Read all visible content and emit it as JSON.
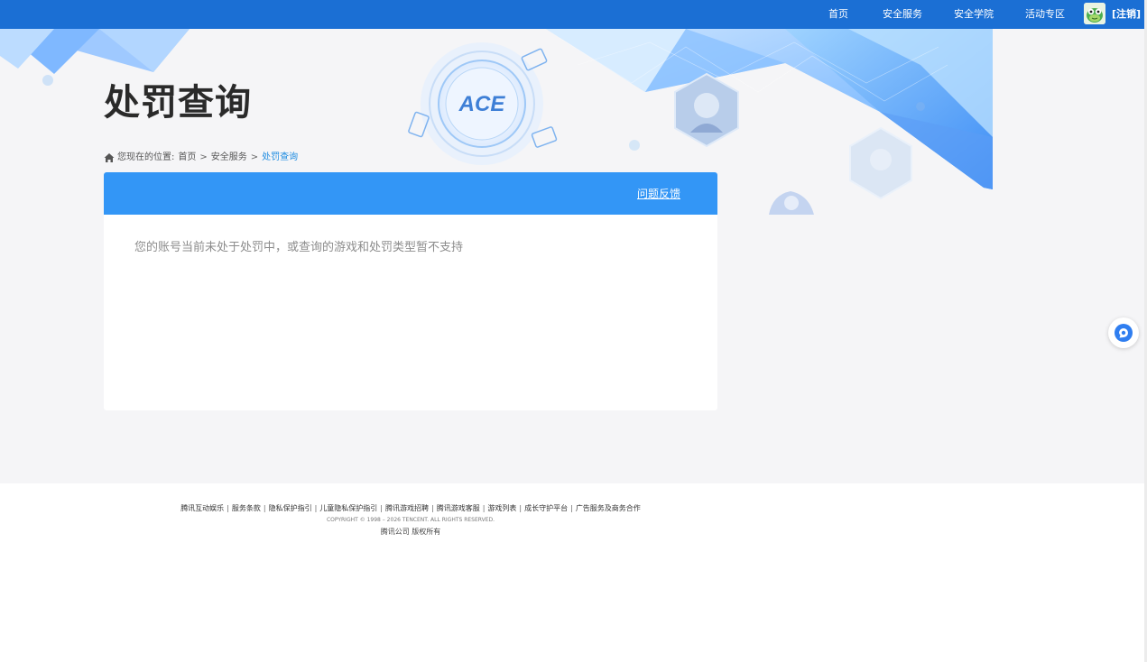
{
  "nav": {
    "items": [
      {
        "label": "首页"
      },
      {
        "label": "安全服务"
      },
      {
        "label": "安全学院"
      },
      {
        "label": "活动专区"
      }
    ],
    "logout_label": "[注销]",
    "avatar_icon": "user-avatar-icon"
  },
  "banner": {
    "logo_text": "ACE"
  },
  "page": {
    "title": "处罚查询"
  },
  "breadcrumb": {
    "prefix": "您现在的位置:",
    "items": [
      "首页",
      "安全服务",
      "处罚查询"
    ],
    "separator": ">",
    "icon": "home-icon"
  },
  "panel": {
    "feedback_label": "问题反馈",
    "empty_message": "您的账号当前未处于处罚中，或查询的游戏和处罚类型暂不支持"
  },
  "floating": {
    "icon": "chat-bubble-icon"
  },
  "footer": {
    "links": [
      "腾讯互动娱乐",
      "服务条款",
      "隐私保护指引",
      "儿童隐私保护指引",
      "腾讯游戏招聘",
      "腾讯游戏客服",
      "游戏列表",
      "成长守护平台",
      "广告服务及商务合作"
    ],
    "separator": "|",
    "copyright": "COPYRIGHT © 1998 – 2026 TENCENT. ALL RIGHTS RESERVED.",
    "company": "腾讯公司 版权所有"
  },
  "colors": {
    "nav_bg": "#1b6fd4",
    "panel_header": "#3396f6",
    "accent": "#1b8ae0",
    "page_bg": "#f5f5f7"
  }
}
